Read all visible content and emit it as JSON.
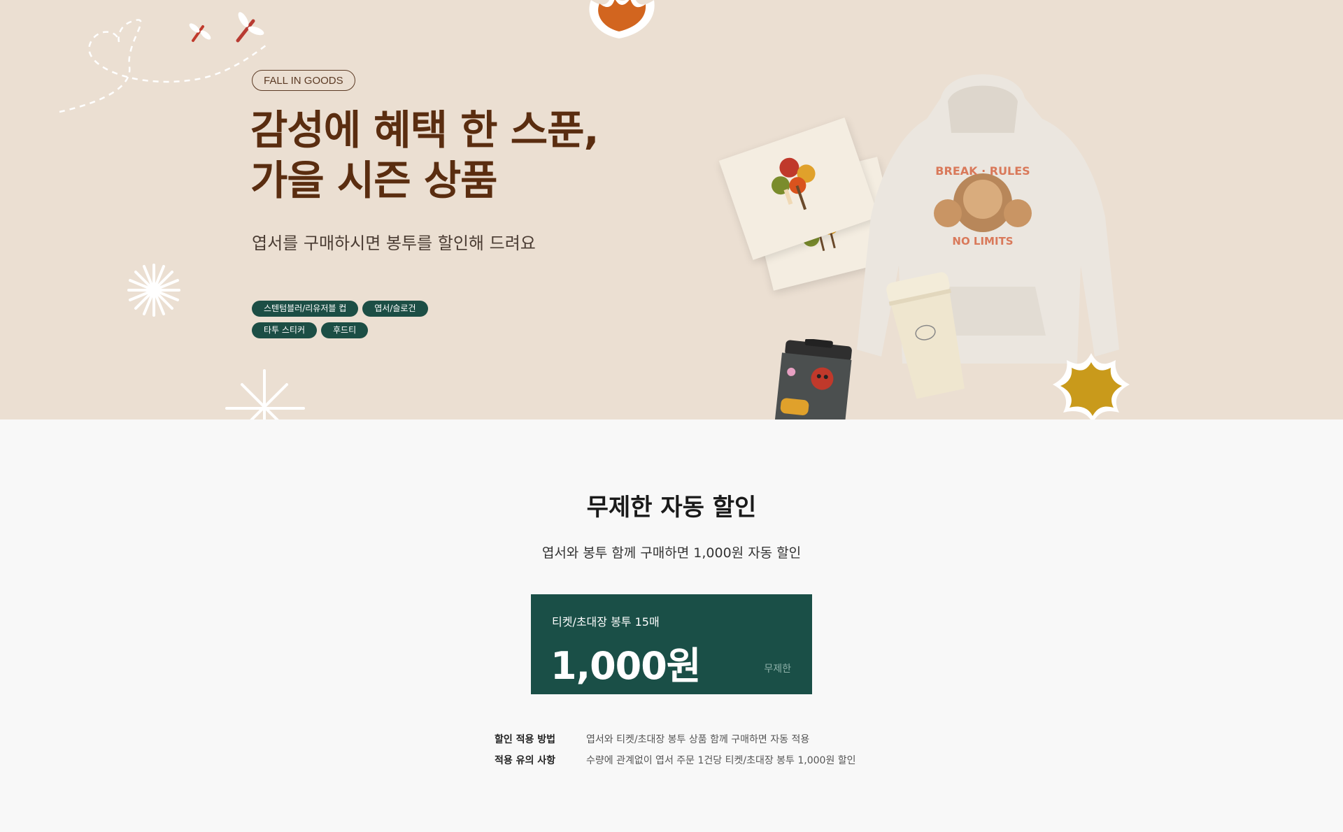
{
  "hero": {
    "eyebrow": "FALL IN GOODS",
    "title_line1": "감성에 혜택 한 스푼,",
    "title_line2": "가을 시즌 상품",
    "subtitle": "엽서를 구매하시면 봉투를 할인해 드려요",
    "tags": [
      "스텐텀블러/리유저블 컵",
      "엽서/슬로건",
      "타투 스티커",
      "후드티"
    ],
    "colors": {
      "background": "#ebdfd2",
      "title": "#5a2d10",
      "tag_bg": "#1c4e45"
    }
  },
  "promo": {
    "title": "무제한 자동 할인",
    "subtitle": "엽서와 봉투 함께 구매하면 1,000원 자동 할인",
    "coupon": {
      "name": "티켓/초대장 봉투 15매",
      "amount": "1,000원",
      "limit": "무제한"
    },
    "info": [
      {
        "label": "할인 적용 방법",
        "value": "엽서와 티켓/초대장 봉투 상품 함께 구매하면 자동 적용"
      },
      {
        "label": "적용 유의 사항",
        "value": "수량에 관계없이 엽서 주문 1건당 티켓/초대장 봉투 1,000원 할인"
      }
    ],
    "colors": {
      "coupon_bg": "#1a4f47"
    }
  }
}
